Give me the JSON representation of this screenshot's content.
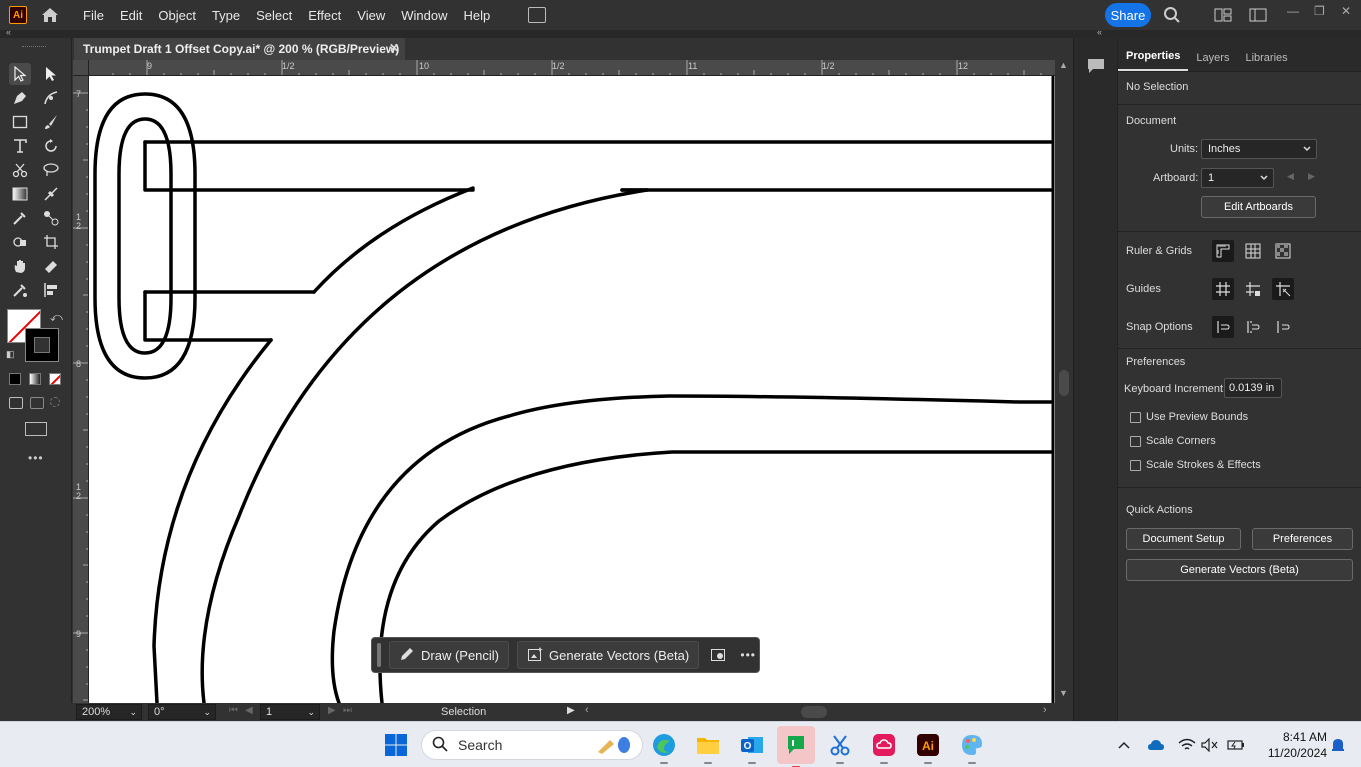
{
  "app": {
    "logo": "Ai",
    "menus": [
      "File",
      "Edit",
      "Object",
      "Type",
      "Select",
      "Effect",
      "View",
      "Window",
      "Help"
    ],
    "share_label": "Share"
  },
  "document": {
    "tab_title": "Trumpet Draft 1 Offset Copy.ai* @ 200 % (RGB/Preview)",
    "close_glyph": "✕"
  },
  "rulers": {
    "h_labels": [
      "9",
      "1/2",
      "10",
      "1/2",
      "11",
      "1/2",
      "12"
    ],
    "v_labels": [
      "7",
      "1\n2",
      "8",
      "1\n2",
      "9"
    ]
  },
  "context_bar": {
    "draw_label": "Draw (Pencil)",
    "generate_label": "Generate Vectors (Beta)",
    "more_glyph": "•••"
  },
  "status": {
    "zoom": "200%",
    "rotation": "0°",
    "artboard_nav": "1",
    "tool": "Selection"
  },
  "properties": {
    "tabs": [
      "Properties",
      "Layers",
      "Libraries"
    ],
    "selection": "No Selection",
    "document_header": "Document",
    "units_label": "Units:",
    "units_value": "Inches",
    "artboard_label": "Artboard:",
    "artboard_value": "1",
    "edit_artboards": "Edit Artboards",
    "ruler_grids": "Ruler & Grids",
    "guides": "Guides",
    "snap_options": "Snap Options",
    "preferences_header": "Preferences",
    "keyboard_increment_label": "Keyboard Increment:",
    "keyboard_increment_value": "0.0139 in",
    "use_preview_bounds": "Use Preview Bounds",
    "scale_corners": "Scale Corners",
    "scale_strokes": "Scale Strokes & Effects",
    "quick_actions": "Quick Actions",
    "document_setup": "Document Setup",
    "preferences_btn": "Preferences",
    "generate_vectors": "Generate Vectors (Beta)"
  },
  "taskbar": {
    "search_placeholder": "Search",
    "time": "8:41 AM",
    "date": "11/20/2024"
  }
}
